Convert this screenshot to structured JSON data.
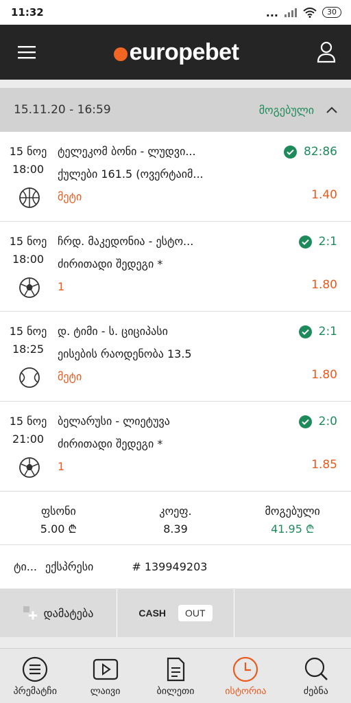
{
  "status_bar": {
    "time": "11:32",
    "signal_dots": "...",
    "battery": "30"
  },
  "header": {
    "brand": "europebet"
  },
  "ticket": {
    "date": "15.11.20 - 16:59",
    "status": "მოგებული",
    "bets": [
      {
        "date": "15 ნოე",
        "time": "18:00",
        "sport": "basketball",
        "event": "ტელეკომ ბონი - ლუდვი...",
        "market": "ქულები 161.5 (ოვერტაიმ...",
        "pick": "მეტი",
        "score": "82:86",
        "odd": "1.40"
      },
      {
        "date": "15 ნოე",
        "time": "18:00",
        "sport": "football",
        "event": "ჩრდ. მაკედონია - ესტო...",
        "market": "ძირითადი შედეგი *",
        "pick": "1",
        "score": "2:1",
        "odd": "1.80"
      },
      {
        "date": "15 ნოე",
        "time": "18:25",
        "sport": "tennis",
        "event": "დ. ტიმი - ს. ციციპასი",
        "market": "ეისების რაოდენობა 13.5",
        "pick": "მეტი",
        "score": "2:1",
        "odd": "1.80"
      },
      {
        "date": "15 ნოე",
        "time": "21:00",
        "sport": "football",
        "event": "ბელარუსი - ლიეტუვა",
        "market": "ძირითადი შედეგი *",
        "pick": "1",
        "score": "2:0",
        "odd": "1.85"
      }
    ],
    "summary": {
      "stake_label": "ფსონი",
      "stake_value": "5.00 ₾",
      "odds_label": "კოეფ.",
      "odds_value": "8.39",
      "win_label": "მოგებული",
      "win_value": "41.95 ₾"
    },
    "type_label": "ტი...",
    "type_value": "ექსპრესი",
    "ticket_number": "# 139949203"
  },
  "actions": {
    "add_label": "დამატება",
    "cash_label": "CASH",
    "out_label": "OUT"
  },
  "bottom_nav": [
    {
      "label": "პრემატჩი",
      "icon": "list-icon"
    },
    {
      "label": "ლაივი",
      "icon": "play-icon"
    },
    {
      "label": "ბილეთი",
      "icon": "ticket-icon"
    },
    {
      "label": "ისტორია",
      "icon": "clock-icon",
      "active": true
    },
    {
      "label": "ძებნა",
      "icon": "search-icon"
    }
  ],
  "colors": {
    "accent": "#ea5a1e",
    "win_green": "#1e8a5c",
    "header_bg": "#252525"
  }
}
